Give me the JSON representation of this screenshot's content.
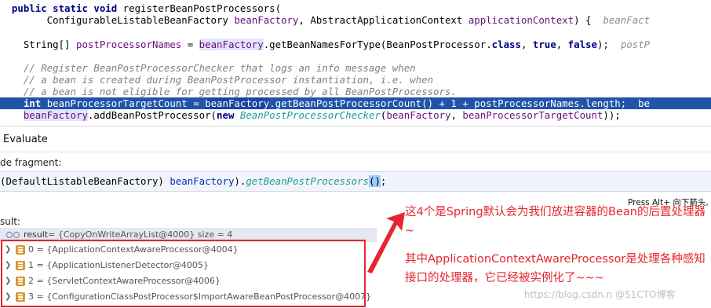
{
  "code": {
    "line1": {
      "kw": "public static void ",
      "method": "registerBeanPostProcessors",
      "rest": "("
    },
    "line2": {
      "t1": "        ConfigurableListableBeanFactory ",
      "v1": "beanFactory",
      "t2": ", AbstractApplicationContext ",
      "v2": "applicationContext",
      "t3": ") {  ",
      "hint": "beanFact"
    },
    "line3": {
      "t1": "    String[] ",
      "v1": "postProcessorNames",
      "t2": " = ",
      "v2": "beanFactory",
      "t3": ".getBeanNamesForType(BeanPostProcessor.",
      "kw1": "class",
      "t4": ", ",
      "kw2": "true",
      "t5": ", ",
      "kw3": "false",
      "t6": ");  ",
      "hint": "postP"
    },
    "comment1": "    // Register BeanPostProcessorChecker that logs an info message when",
    "comment2": "    // a bean is created during BeanPostProcessor instantiation, i.e. when",
    "comment3": "    // a bean is not eligible for getting processed by all BeanPostProcessors.",
    "line7": {
      "t1": "    ",
      "kw": "int",
      "t2": " beanProcessorTargetCount = ",
      "v1": "beanFactory",
      "t3": ".getBeanPostProcessorCount() + 1 + postProcessorNames.length;  ",
      "hint": "be"
    },
    "line8": {
      "t1": "    ",
      "v1": "beanFactory",
      "t2": ".addBeanPostProcessor(",
      "kw": "new ",
      "cls": "BeanPostProcessorChecker",
      "t3": "(",
      "v2": "beanFactory",
      "t4": ", ",
      "v3": "beanProcessorTargetCount",
      "t5": "));"
    }
  },
  "evaluate": {
    "title": "Evaluate",
    "fragment_label": "de fragment:",
    "expr": {
      "p1": "(DefaultListableBeanFactory) ",
      "v1": "beanFactory",
      "p2": ").",
      "method": "getBeanPostProcessors",
      "paren": "()",
      "p3": ";"
    },
    "press_hint": "Press Alt+ 向下箭头, A",
    "result_label": "sult:"
  },
  "result_tree": {
    "root": {
      "name": "result",
      "value": " = {CopyOnWriteArrayList@4000}  size = 4"
    },
    "items": [
      {
        "label": "0 = {ApplicationContextAwareProcessor@4004}"
      },
      {
        "label": "1 = {ApplicationListenerDetector@4005}"
      },
      {
        "label": "2 = {ServletContextAwareProcessor@4006}"
      },
      {
        "label": "3 = {ConfigurationClassPostProcessor$ImportAwareBeanPostProcessor@4007}"
      }
    ]
  },
  "annotations": {
    "note1": "这4个是Spring默认会为我们放进容器的Bean的后置处理器~",
    "note2": "其中ApplicationContextAwareProcessor是处理各种感知接口的处理器，它已经被实例化了~~~"
  },
  "watermark": "https://blog.csdn.n @51CTO博客",
  "colors": {
    "highlight_line": "#2154a8",
    "annotation_red": "#e6252e",
    "keyword": "#000080",
    "field_var": "#660e7a"
  },
  "icons": {
    "watch": "glasses-icon",
    "list": "list-icon",
    "expand": "chevron-right-icon"
  }
}
